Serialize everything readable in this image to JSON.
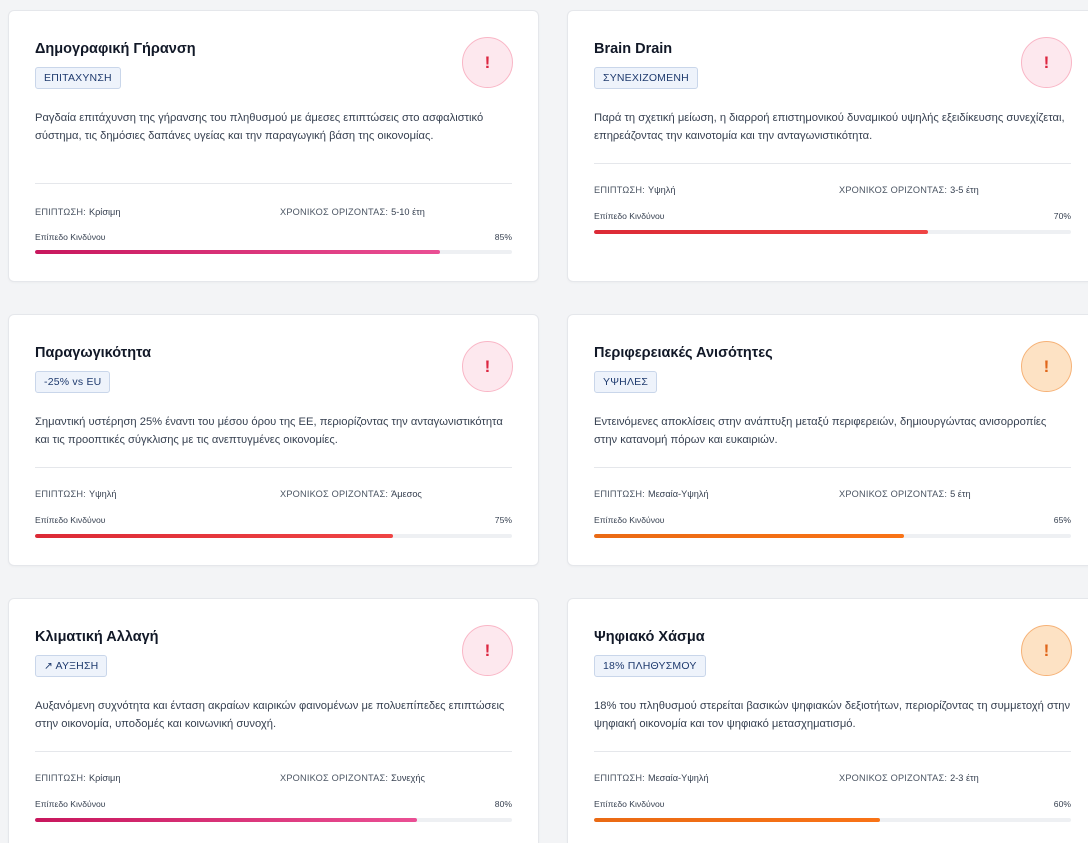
{
  "labels": {
    "impact": "ΕΠΙΠΤΩΣΗ:",
    "horizon": "ΧΡΟΝΙΚΟΣ ΟΡΙΖΟΝΤΑΣ:",
    "risk_level": "Επίπεδο Κινδύνου"
  },
  "alert_symbol": "!",
  "cards": [
    {
      "title": "Δημογραφική Γήρανση",
      "badge": "ΕΠΙΤΑΧΥΝΣΗ",
      "description": "Ραγδαία επιτάχυνση της γήρανσης του πληθυσμού με άμεσες επιπτώσεις στο ασφαλιστικό σύστημα, τις δημόσιες δαπάνες υγείας και την παραγωγική βάση της οικονομίας.",
      "impact": "Κρίσιμη",
      "horizon": "5-10 έτη",
      "risk_label": "85%",
      "risk_value": 85,
      "severity": "critical",
      "alert_color": "red",
      "bar_colors": [
        "#c8175d",
        "#ea4f94"
      ]
    },
    {
      "title": "Brain Drain",
      "badge": "ΣΥΝΕΧΙΖΟΜΕΝΗ",
      "description": "Παρά τη σχετική μείωση, η διαρροή επιστημονικού δυναμικού υψηλής εξειδίκευσης συνεχίζεται, επηρεάζοντας την καινοτομία και την ανταγωνιστικότητα.",
      "impact": "Υψηλή",
      "horizon": "3-5 έτη",
      "risk_label": "70%",
      "risk_value": 70,
      "severity": "high",
      "alert_color": "red",
      "bar_colors": [
        "#dc2a36",
        "#ef4444"
      ]
    },
    {
      "title": "Παραγωγικότητα",
      "badge": "-25% vs EU",
      "description": "Σημαντική υστέρηση 25% έναντι του μέσου όρου της ΕΕ, περιορίζοντας την ανταγωνιστικότητα και τις προοπτικές σύγκλισης με τις ανεπτυγμένες οικονομίες.",
      "impact": "Υψηλή",
      "horizon": "Άμεσος",
      "risk_label": "75%",
      "risk_value": 75,
      "severity": "high",
      "alert_color": "red",
      "bar_colors": [
        "#dc2a36",
        "#ef4444"
      ]
    },
    {
      "title": "Περιφερειακές Ανισότητες",
      "badge": "ΥΨΗΛΕΣ",
      "description": "Εντεινόμενες αποκλίσεις στην ανάπτυξη μεταξύ περιφερειών, δημιουργώντας ανισορροπίες στην κατανομή πόρων και ευκαιριών.",
      "impact": "Μεσαία-Υψηλή",
      "horizon": "5 έτη",
      "risk_label": "65%",
      "risk_value": 65,
      "severity": "medium-high",
      "alert_color": "orange",
      "bar_colors": [
        "#ea6a14",
        "#f97316"
      ]
    },
    {
      "title": "Κλιματική Αλλαγή",
      "badge": "↗ ΑΥΞΗΣΗ",
      "description": "Αυξανόμενη συχνότητα και ένταση ακραίων καιρικών φαινομένων με πολυεπίπεδες επιπτώσεις στην οικονομία, υποδομές και κοινωνική συνοχή.",
      "impact": "Κρίσιμη",
      "horizon": "Συνεχής",
      "risk_label": "80%",
      "risk_value": 80,
      "severity": "critical",
      "alert_color": "red",
      "bar_colors": [
        "#c8175d",
        "#ea4f94"
      ]
    },
    {
      "title": "Ψηφιακό Χάσμα",
      "badge": "18% ΠΛΗΘΥΣΜΟΥ",
      "description": "18% του πληθυσμού στερείται βασικών ψηφιακών δεξιοτήτων, περιορίζοντας τη συμμετοχή στην ψηφιακή οικονομία και τον ψηφιακό μετασχηματισμό.",
      "impact": "Μεσαία-Υψηλή",
      "horizon": "2-3 έτη",
      "risk_label": "60%",
      "risk_value": 60,
      "severity": "medium-high",
      "alert_color": "orange",
      "bar_colors": [
        "#ea6a14",
        "#f97316"
      ]
    }
  ]
}
